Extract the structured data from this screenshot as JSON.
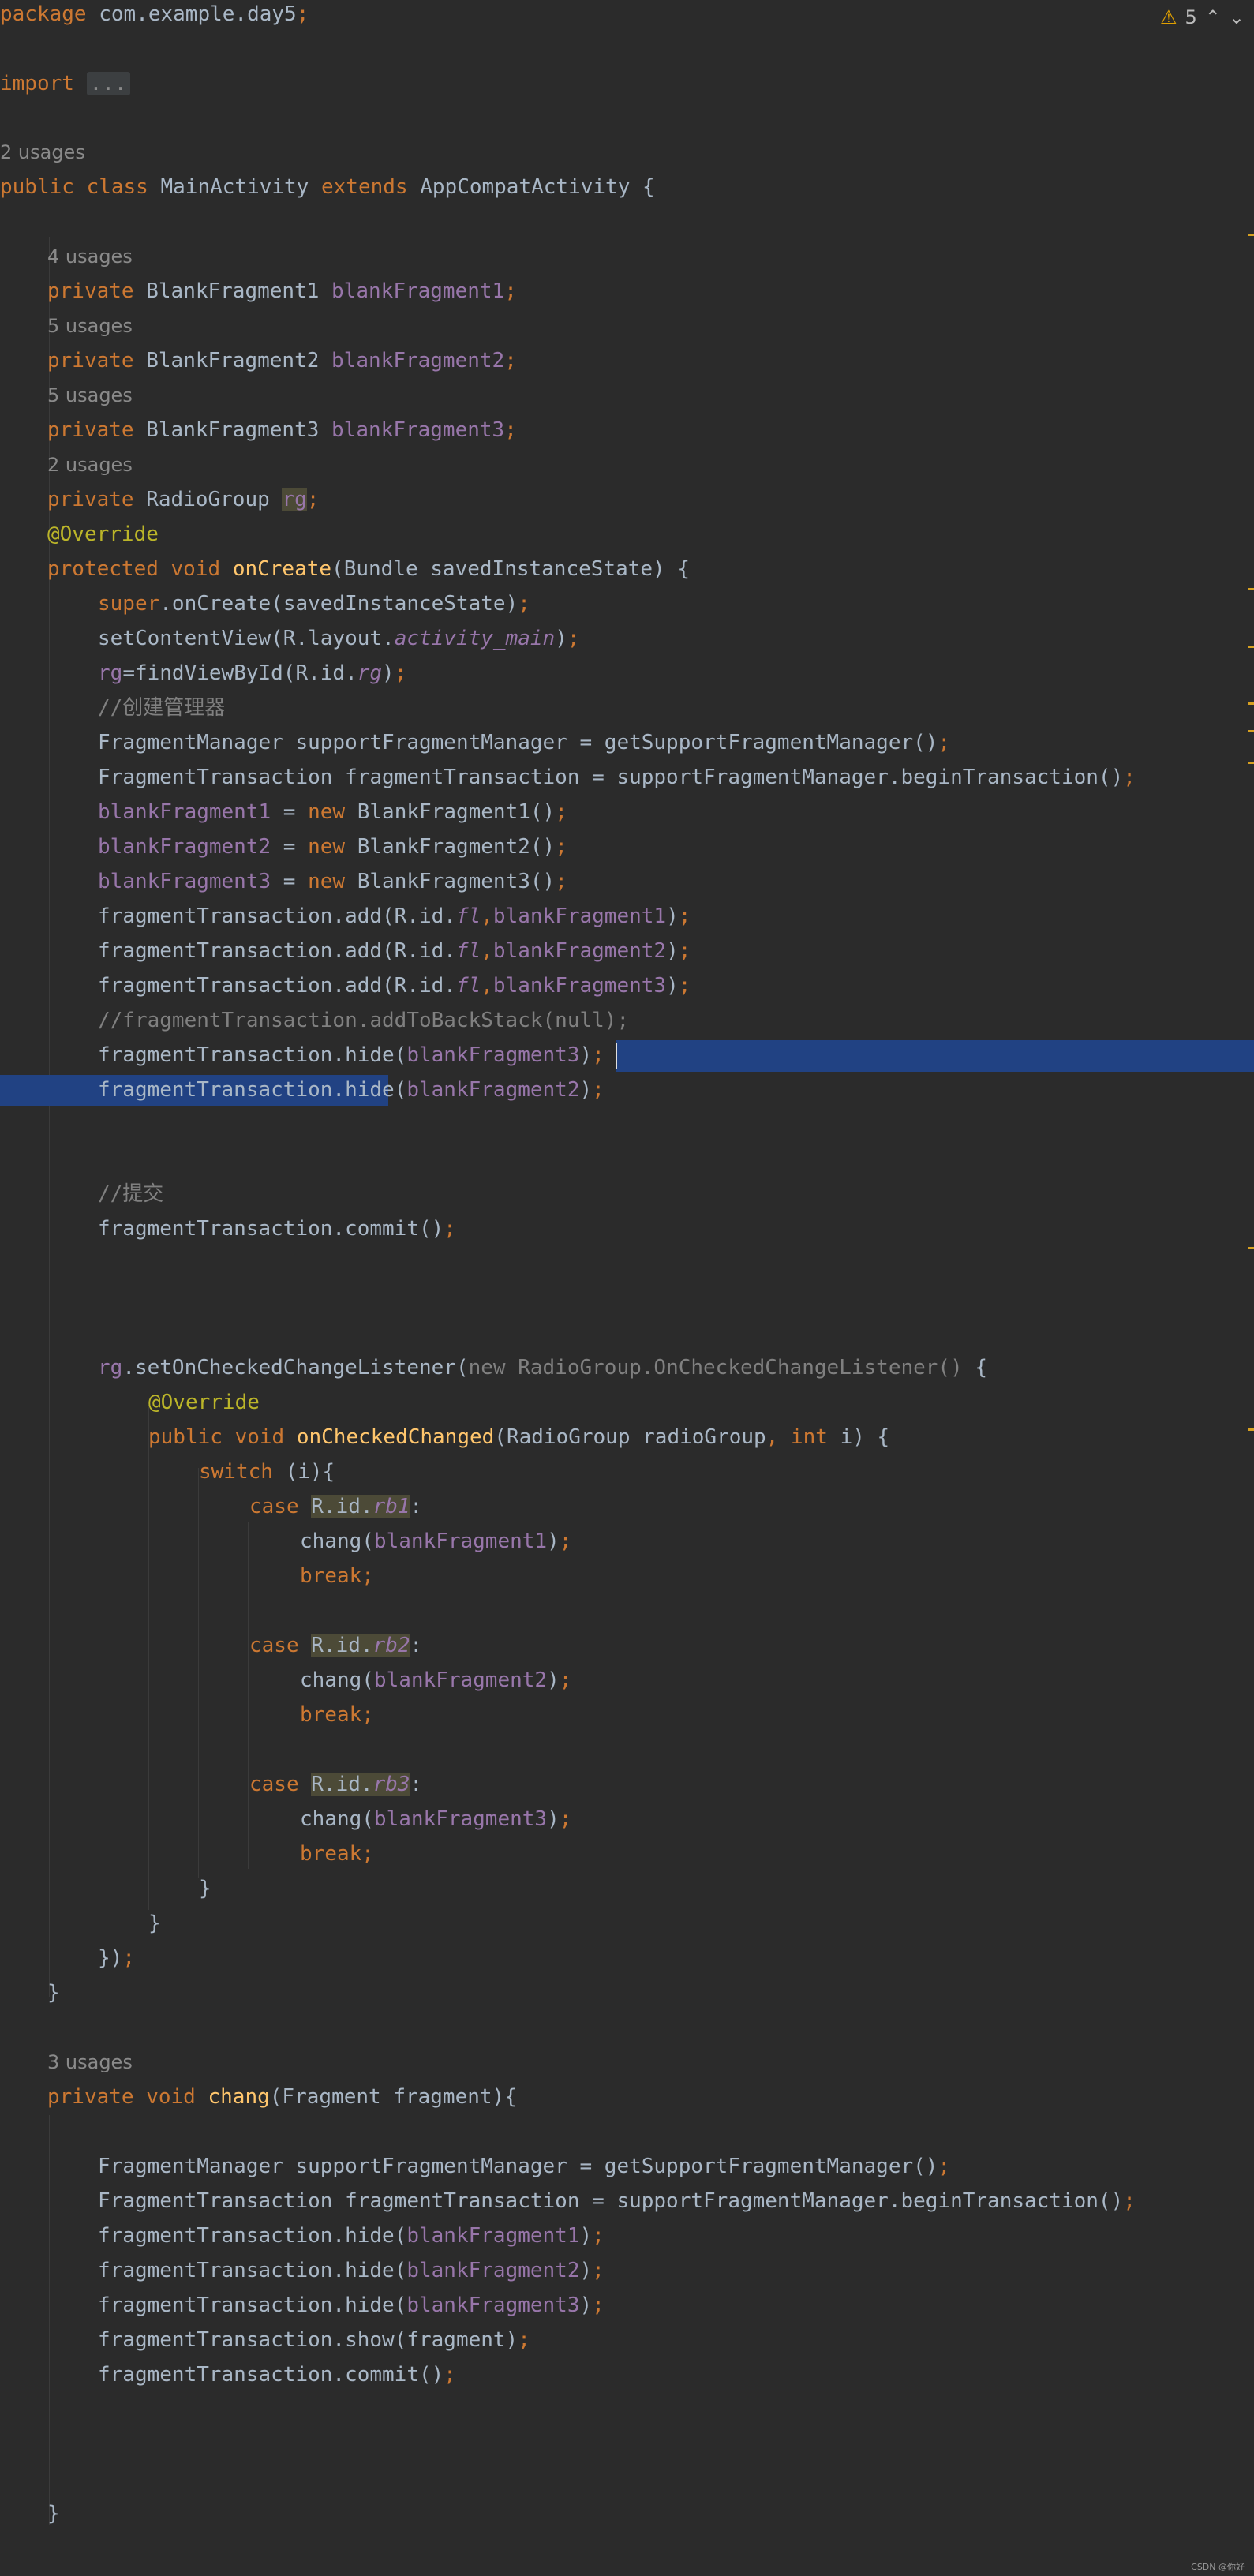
{
  "inspection": {
    "warning_count": "5",
    "icon": "warning-triangle-icon",
    "prev_icon": "chevron-up-icon",
    "next_icon": "chevron-down-icon"
  },
  "watermark": "CSDN @你好",
  "colors": {
    "background": "#2b2b2b",
    "keyword": "#cc7832",
    "field": "#9876aa",
    "annotation": "#bbb529",
    "method": "#ffc66d",
    "comment": "#808080",
    "selection": "#214283"
  },
  "code": {
    "l1": [
      [
        "kw",
        "package "
      ],
      [
        "ty",
        "com.example.day5"
      ],
      [
        "kw",
        ";"
      ]
    ],
    "l2": [
      [
        "kw",
        "import "
      ],
      [
        "fold",
        "..."
      ]
    ],
    "l3": [
      [
        "usage",
        "2 usages"
      ]
    ],
    "l4": [
      [
        "kw",
        "public class "
      ],
      [
        "ty",
        "MainActivity "
      ],
      [
        "kw",
        "extends "
      ],
      [
        "ty",
        "AppCompatActivity {"
      ]
    ],
    "l5": [
      [
        "usage",
        "4 usages"
      ]
    ],
    "l6": [
      [
        "kw",
        "private "
      ],
      [
        "ty",
        "BlankFragment1 "
      ],
      [
        "fld",
        "blankFragment1"
      ],
      [
        "kw",
        ";"
      ]
    ],
    "l7": [
      [
        "usage",
        "5 usages"
      ]
    ],
    "l8": [
      [
        "kw",
        "private "
      ],
      [
        "ty",
        "BlankFragment2 "
      ],
      [
        "fld",
        "blankFragment2"
      ],
      [
        "kw",
        ";"
      ]
    ],
    "l9": [
      [
        "usage",
        "5 usages"
      ]
    ],
    "l10": [
      [
        "kw",
        "private "
      ],
      [
        "ty",
        "BlankFragment3 "
      ],
      [
        "fld",
        "blankFragment3"
      ],
      [
        "kw",
        ";"
      ]
    ],
    "l11": [
      [
        "usage",
        "2 usages"
      ]
    ],
    "l12": [
      [
        "kw",
        "private "
      ],
      [
        "ty",
        "RadioGroup "
      ],
      [
        "fldhl",
        "rg"
      ],
      [
        "kw",
        ";"
      ]
    ],
    "l13": [
      [
        "ann",
        "@Override"
      ]
    ],
    "l14": [
      [
        "kw",
        "protected void "
      ],
      [
        "meth",
        "onCreate"
      ],
      [
        "ty",
        "(Bundle savedInstanceState) {"
      ]
    ],
    "l15": [
      [
        "kw",
        "super"
      ],
      [
        "ty",
        ".onCreate(savedInstanceState)"
      ],
      [
        "kw",
        ";"
      ]
    ],
    "l16": [
      [
        "ty",
        "setContentView(R.layout."
      ],
      [
        "fldi",
        "activity_main"
      ],
      [
        "ty",
        ")"
      ],
      [
        "kw",
        ";"
      ]
    ],
    "l17": [
      [
        "fld",
        "rg"
      ],
      [
        "ty",
        "=findViewById(R.id."
      ],
      [
        "fldi",
        "rg"
      ],
      [
        "ty",
        ")"
      ],
      [
        "kw",
        ";"
      ]
    ],
    "l18": [
      [
        "cmt",
        "//创建管理器"
      ]
    ],
    "l19": [
      [
        "ty",
        "FragmentManager supportFragmentManager = getSupportFragmentManager()"
      ],
      [
        "kw",
        ";"
      ]
    ],
    "l20": [
      [
        "ty",
        "FragmentTransaction fragmentTransaction = supportFragmentManager.beginTransaction()"
      ],
      [
        "kw",
        ";"
      ]
    ],
    "l21": [
      [
        "fld",
        "blankFragment1"
      ],
      [
        "ty",
        " = "
      ],
      [
        "kw",
        "new "
      ],
      [
        "ty",
        "BlankFragment1()"
      ],
      [
        "kw",
        ";"
      ]
    ],
    "l22": [
      [
        "fld",
        "blankFragment2"
      ],
      [
        "ty",
        " = "
      ],
      [
        "kw",
        "new "
      ],
      [
        "ty",
        "BlankFragment2()"
      ],
      [
        "kw",
        ";"
      ]
    ],
    "l23": [
      [
        "fld",
        "blankFragment3"
      ],
      [
        "ty",
        " = "
      ],
      [
        "kw",
        "new "
      ],
      [
        "ty",
        "BlankFragment3()"
      ],
      [
        "kw",
        ";"
      ]
    ],
    "l24": [
      [
        "ty",
        "fragmentTransaction.add(R.id."
      ],
      [
        "fldi",
        "fl"
      ],
      [
        "kw",
        ","
      ],
      [
        "fld",
        "blankFragment1"
      ],
      [
        "ty",
        ")"
      ],
      [
        "kw",
        ";"
      ]
    ],
    "l25": [
      [
        "ty",
        "fragmentTransaction.add(R.id."
      ],
      [
        "fldi",
        "fl"
      ],
      [
        "kw",
        ","
      ],
      [
        "fld",
        "blankFragment2"
      ],
      [
        "ty",
        ")"
      ],
      [
        "kw",
        ";"
      ]
    ],
    "l26": [
      [
        "ty",
        "fragmentTransaction.add(R.id."
      ],
      [
        "fldi",
        "fl"
      ],
      [
        "kw",
        ","
      ],
      [
        "fld",
        "blankFragment3"
      ],
      [
        "ty",
        ")"
      ],
      [
        "kw",
        ";"
      ]
    ],
    "l27": [
      [
        "cmt",
        "//fragmentTransaction.addToBackStack(null);"
      ]
    ],
    "l28": [
      [
        "ty",
        "fragmentTransaction.hide("
      ],
      [
        "fld",
        "blankFragment3"
      ],
      [
        "ty",
        ")"
      ],
      [
        "kw",
        ";"
      ]
    ],
    "l29": [
      [
        "ty",
        "fragmentTransaction.hide("
      ],
      [
        "fld",
        "blankFragment2"
      ],
      [
        "ty",
        ")"
      ],
      [
        "kw",
        ";"
      ]
    ],
    "l30": [
      [
        "cmt",
        "//提交"
      ]
    ],
    "l31": [
      [
        "ty",
        "fragmentTransaction.commit()"
      ],
      [
        "kw",
        ";"
      ]
    ],
    "l32": [
      [
        "fld",
        "rg"
      ],
      [
        "ty",
        ".setOnCheckedChangeListener("
      ],
      [
        "gray",
        "new RadioGroup.OnCheckedChangeListener() "
      ],
      [
        "ty",
        "{"
      ]
    ],
    "l33": [
      [
        "ann",
        "@Override"
      ]
    ],
    "l34": [
      [
        "kw",
        "public void "
      ],
      [
        "meth",
        "onCheckedChanged"
      ],
      [
        "ty",
        "(RadioGroup radioGroup"
      ],
      [
        "kw",
        ", int "
      ],
      [
        "ty",
        "i) {"
      ]
    ],
    "l35": [
      [
        "kw",
        "switch "
      ],
      [
        "ty",
        "(i){"
      ]
    ],
    "l36": [
      [
        "kw",
        "case "
      ],
      [
        "hlty",
        "R.id."
      ],
      [
        "hlfldi",
        "rb1"
      ],
      [
        "ty",
        ":"
      ]
    ],
    "l37": [
      [
        "ty",
        "chang("
      ],
      [
        "fld",
        "blankFragment1"
      ],
      [
        "ty",
        ")"
      ],
      [
        "kw",
        ";"
      ]
    ],
    "l38": [
      [
        "kw",
        "break;"
      ]
    ],
    "l39": [
      [
        "kw",
        "case "
      ],
      [
        "hlty",
        "R.id."
      ],
      [
        "hlfldi",
        "rb2"
      ],
      [
        "ty",
        ":"
      ]
    ],
    "l40": [
      [
        "ty",
        "chang("
      ],
      [
        "fld",
        "blankFragment2"
      ],
      [
        "ty",
        ")"
      ],
      [
        "kw",
        ";"
      ]
    ],
    "l41": [
      [
        "kw",
        "break;"
      ]
    ],
    "l42": [
      [
        "kw",
        "case "
      ],
      [
        "hlty",
        "R.id."
      ],
      [
        "hlfldi",
        "rb3"
      ],
      [
        "ty",
        ":"
      ]
    ],
    "l43": [
      [
        "ty",
        "chang("
      ],
      [
        "fld",
        "blankFragment3"
      ],
      [
        "ty",
        ")"
      ],
      [
        "kw",
        ";"
      ]
    ],
    "l44": [
      [
        "kw",
        "break;"
      ]
    ],
    "l45": [
      [
        "ty",
        "}"
      ]
    ],
    "l46": [
      [
        "ty",
        "}"
      ]
    ],
    "l47": [
      [
        "ty",
        "})"
      ],
      [
        "kw",
        ";"
      ]
    ],
    "l48": [
      [
        "ty",
        "}"
      ]
    ],
    "l49": [
      [
        "usage",
        "3 usages"
      ]
    ],
    "l50": [
      [
        "kw",
        "private void "
      ],
      [
        "meth",
        "chang"
      ],
      [
        "ty",
        "(Fragment fragment){"
      ]
    ],
    "l51": [
      [
        "ty",
        "FragmentManager supportFragmentManager = getSupportFragmentManager()"
      ],
      [
        "kw",
        ";"
      ]
    ],
    "l52": [
      [
        "ty",
        "FragmentTransaction fragmentTransaction = supportFragmentManager.beginTransaction()"
      ],
      [
        "kw",
        ";"
      ]
    ],
    "l53": [
      [
        "ty",
        "fragmentTransaction.hide("
      ],
      [
        "fld",
        "blankFragment1"
      ],
      [
        "ty",
        ")"
      ],
      [
        "kw",
        ";"
      ]
    ],
    "l54": [
      [
        "ty",
        "fragmentTransaction.hide("
      ],
      [
        "fld",
        "blankFragment2"
      ],
      [
        "ty",
        ")"
      ],
      [
        "kw",
        ";"
      ]
    ],
    "l55": [
      [
        "ty",
        "fragmentTransaction.hide("
      ],
      [
        "fld",
        "blankFragment3"
      ],
      [
        "ty",
        ")"
      ],
      [
        "kw",
        ";"
      ]
    ],
    "l56": [
      [
        "ty",
        "fragmentTransaction.show(fragment)"
      ],
      [
        "kw",
        ";"
      ]
    ],
    "l57": [
      [
        "ty",
        "fragmentTransaction.commit()"
      ],
      [
        "kw",
        ";"
      ]
    ],
    "l58": [
      [
        "ty",
        "}"
      ]
    ]
  }
}
